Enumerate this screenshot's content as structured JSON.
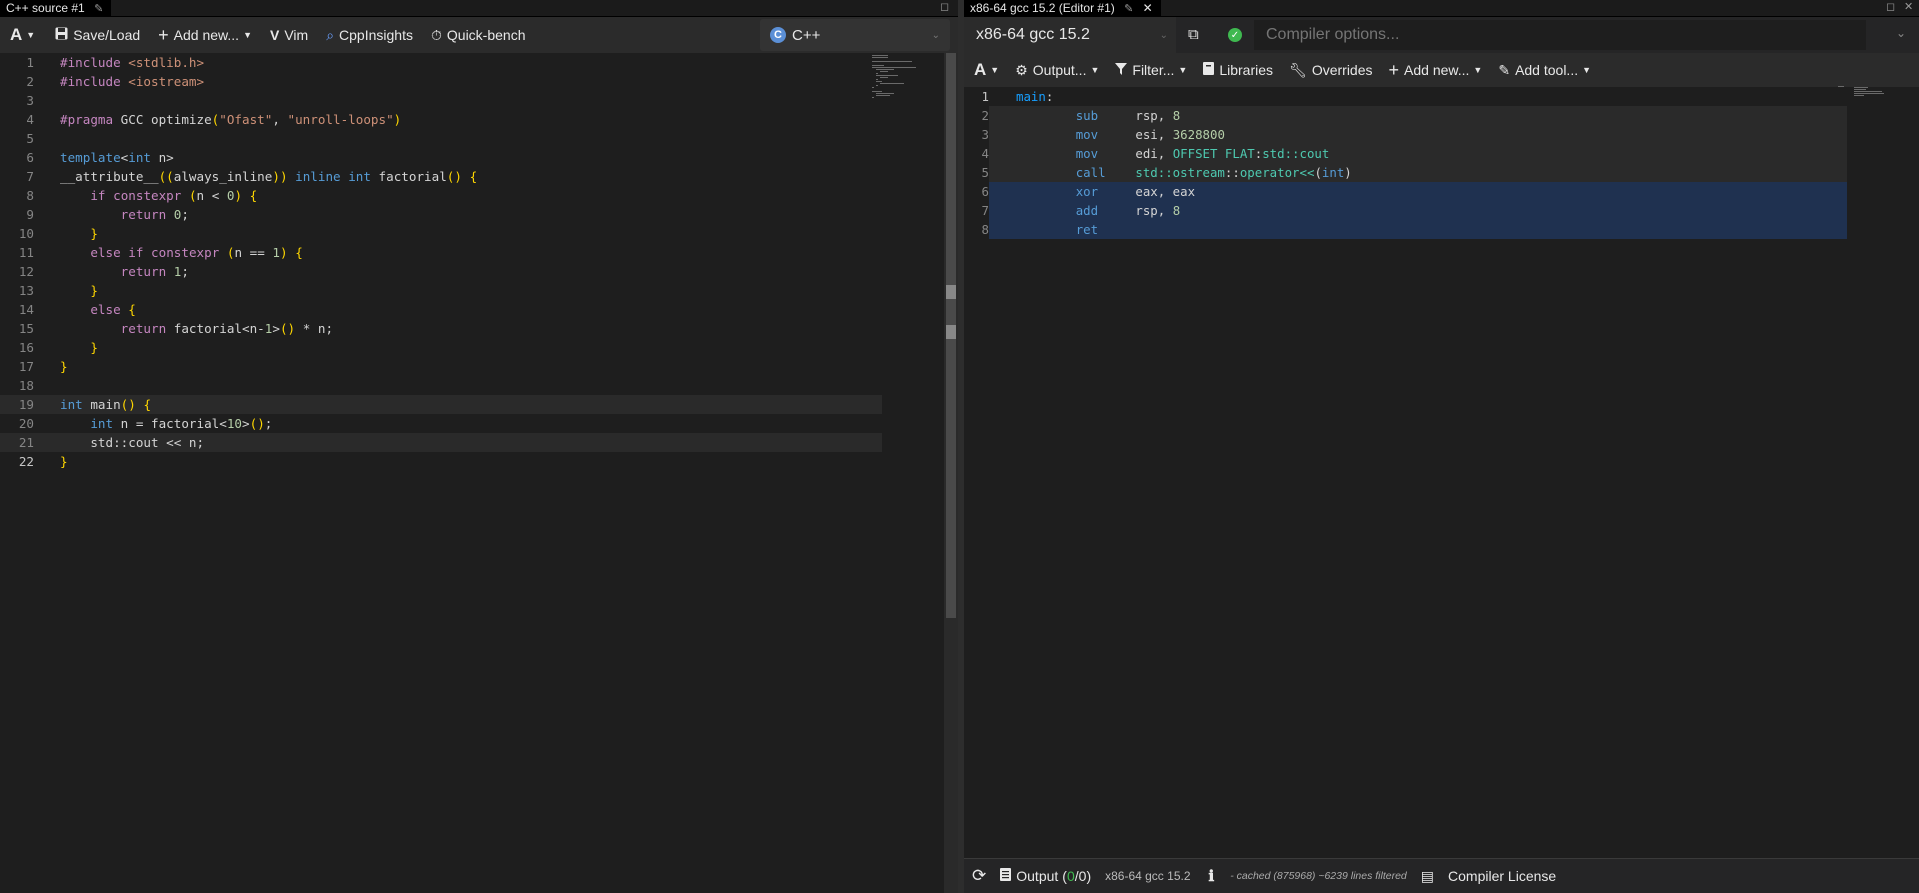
{
  "left": {
    "tab_title": "C++ source #1",
    "toolbar": {
      "font_btn": "A",
      "save_load": "Save/Load",
      "add_new": "Add new...",
      "vim": "Vim",
      "cppinsights": "CppInsights",
      "quickbench": "Quick-bench",
      "language": "C++"
    },
    "source_lines": [
      "#include <stdlib.h>",
      "#include <iostream>",
      "",
      "#pragma GCC optimize(\"Ofast\", \"unroll-loops\")",
      "",
      "template<int n>",
      "__attribute__((always_inline)) inline int factorial() {",
      "    if constexpr (n < 0) {",
      "        return 0;",
      "    }",
      "    else if constexpr (n == 1) {",
      "        return 1;",
      "    }",
      "    else {",
      "        return factorial<n-1>() * n;",
      "    }",
      "}",
      "",
      "int main() {",
      "    int n = factorial<10>();",
      "    std::cout << n;",
      "}"
    ],
    "line_numbers": [
      "1",
      "2",
      "3",
      "4",
      "5",
      "6",
      "7",
      "8",
      "9",
      "10",
      "11",
      "12",
      "13",
      "14",
      "15",
      "16",
      "17",
      "18",
      "19",
      "20",
      "21",
      "22"
    ]
  },
  "right": {
    "tab_title": "x86-64 gcc 15.2 (Editor #1)",
    "compiler_name": "x86-64 gcc 15.2",
    "compiler_options_placeholder": "Compiler options...",
    "toolbar": {
      "font_btn": "A",
      "output": "Output...",
      "filter": "Filter...",
      "libraries": "Libraries",
      "overrides": "Overrides",
      "add_new": "Add new...",
      "add_tool": "Add tool..."
    },
    "asm_lines": [
      "main:",
      "        sub     rsp, 8",
      "        mov     esi, 3628800",
      "        mov     edi, OFFSET FLAT:std::cout",
      "        call    std::ostream::operator<<(int)",
      "        xor     eax, eax",
      "        add     rsp, 8",
      "        ret"
    ],
    "asm_line_numbers": [
      "1",
      "2",
      "3",
      "4",
      "5",
      "6",
      "7",
      "8"
    ],
    "status": {
      "output_label": "Output",
      "output_count_open": "(",
      "output_count_a": "0",
      "output_count_sep": "/",
      "output_count_b": "0",
      "output_count_close": ")",
      "compiler": "x86-64 gcc 15.2",
      "cache_info": "- cached (875968) ~6239 lines filtered",
      "license": "Compiler License"
    }
  },
  "colors": {
    "keyword": "#569cd6",
    "directive": "#c586c0",
    "string": "#ce9178",
    "number": "#b5cea8",
    "asm_highlight": "#1f3150",
    "success": "#3fb950"
  }
}
